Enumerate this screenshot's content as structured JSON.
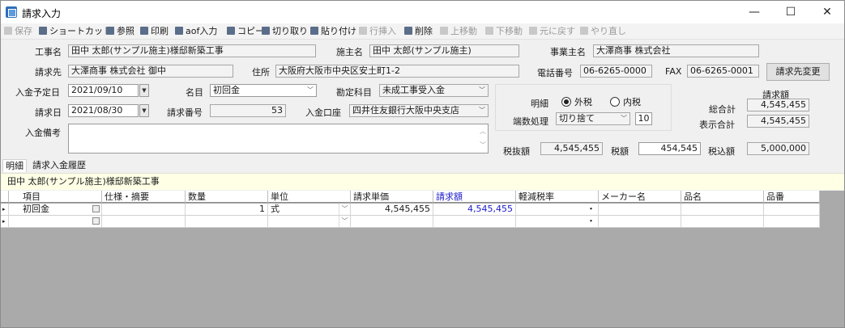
{
  "window": {
    "title": "請求入力",
    "minimize": "—",
    "maximize": "☐",
    "close": "✕"
  },
  "toolbar": {
    "save": "保存",
    "shortcut": "ショートカット",
    "reference": "参照",
    "print": "印刷",
    "aof_input": "aof入力",
    "copy": "コピー",
    "cut": "切り取り",
    "paste": "貼り付け",
    "insert_row": "行挿入",
    "delete": "削除",
    "move_up": "上移動",
    "move_down": "下移動",
    "undo": "元に戻す",
    "redo": "やり直し"
  },
  "form": {
    "project_label": "工事名",
    "project_value": "田中 太郎(サンプル施主)様邸新築工事",
    "owner_label": "施主名",
    "owner_value": "田中 太郎(サンプル施主)",
    "business_owner_label": "事業主名",
    "business_owner_value": "大澤商事 株式会社",
    "billing_to_label": "請求先",
    "billing_to_value": "大澤商事 株式会社 御中",
    "address_label": "住所",
    "address_value": "大阪府大阪市中央区安土町1-2",
    "phone_label": "電話番号",
    "phone_value": "06-6265-0000",
    "fax_label": "FAX",
    "fax_value": "06-6265-0001",
    "change_billing_button": "請求先変更",
    "deposit_date_label": "入金予定日",
    "deposit_date_value": "2021/09/10",
    "item_name_label": "名目",
    "item_name_value": "初回金",
    "account_label": "勘定科目",
    "account_value": "未成工事受入金",
    "billing_date_label": "請求日",
    "billing_date_value": "2021/08/30",
    "billing_number_label": "請求番号",
    "billing_number_value": "53",
    "deposit_account_label": "入金口座",
    "deposit_account_value": "四井住友銀行大阪中央支店",
    "deposit_note_label": "入金備考",
    "detail_label": "明細",
    "tax_exclusive": "外税",
    "tax_inclusive": "内税",
    "rounding_label": "端数処理",
    "rounding_value": "切り捨て",
    "rounding_digits": "10",
    "billing_amount_header": "請求額",
    "grand_total_label": "総合計",
    "grand_total_value": "4,545,455",
    "display_total_label": "表示合計",
    "display_total_value": "4,545,455",
    "pretax_label": "税抜額",
    "pretax_value": "4,545,455",
    "tax_label": "税額",
    "tax_value": "454,545",
    "with_tax_label": "税込額",
    "with_tax_value": "5,000,000"
  },
  "tabs": {
    "detail": "明細",
    "history": "請求入金履歴"
  },
  "banner": "田中 太郎(サンプル施主)様邸新築工事",
  "grid": {
    "columns": [
      "項目",
      "仕様・摘要",
      "数量",
      "単位",
      "請求単価",
      "請求額",
      "軽減税率",
      "メーカー名",
      "品名",
      "品番"
    ],
    "rows": [
      [
        "初回金",
        "",
        "1",
        "式",
        "4,545,455",
        "4,545,455",
        "・",
        "",
        "",
        ""
      ],
      [
        "",
        "",
        "",
        "",
        "",
        "",
        "・",
        "",
        "",
        ""
      ]
    ],
    "highlight_color": "#1a1acc"
  }
}
